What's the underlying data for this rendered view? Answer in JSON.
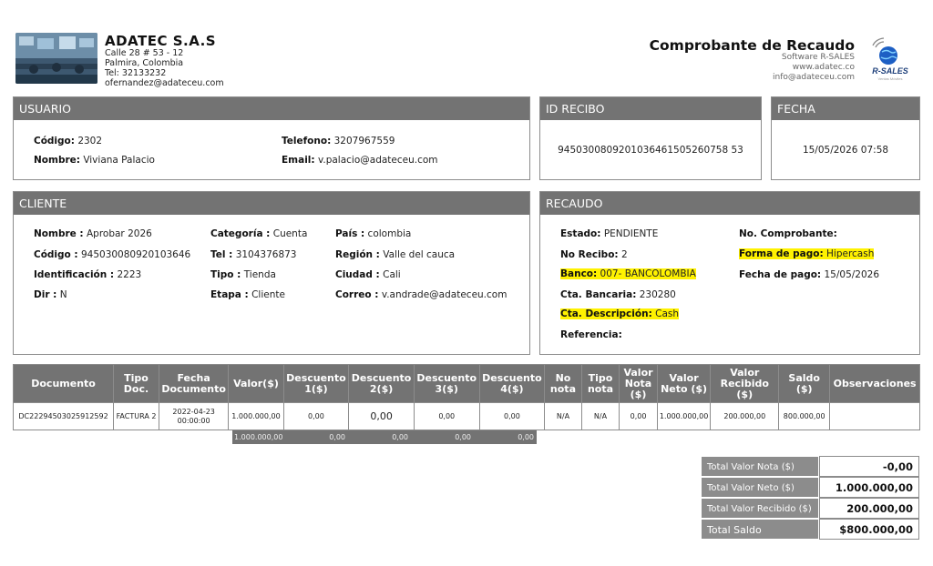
{
  "company": {
    "name": "ADATEC S.A.S",
    "address": "Calle 28 # 53 - 12",
    "city": "Palmira, Colombia",
    "tel": "Tel: 32133232",
    "email": "ofernandez@adateceu.com"
  },
  "document": {
    "title": "Comprobante de Recaudo",
    "software": "Software R-SALES",
    "website": "www.adatec.co",
    "email": "info@adateceu.com"
  },
  "brand_logo": {
    "text": "R-SALES",
    "subtext": "Ventas Móviles",
    "icon": "globe-wifi-icon"
  },
  "usuario": {
    "header": "USUARIO",
    "codigo_label": "Código:",
    "codigo": "2302",
    "nombre_label": "Nombre:",
    "nombre": "Viviana Palacio",
    "telefono_label": "Telefono:",
    "telefono": "3207967559",
    "email_label": "Email:",
    "email": "v.palacio@adateceu.com"
  },
  "id_recibo": {
    "header": "ID RECIBO",
    "value": "9450300809201036461505260758 53"
  },
  "fecha": {
    "header": "FECHA",
    "value": "15/05/2026 07:58"
  },
  "cliente": {
    "header": "CLIENTE",
    "nombre_label": "Nombre :",
    "nombre": "Aprobar 2026",
    "codigo_label": "Código :",
    "codigo": "945030080920103646",
    "identificacion_label": "Identificación :",
    "identificacion": "2223",
    "dir_label": "Dir :",
    "dir": "N",
    "categoria_label": "Categoría :",
    "categoria": "Cuenta",
    "tel_label": "Tel :",
    "tel": "3104376873",
    "tipo_label": "Tipo :",
    "tipo": "Tienda",
    "etapa_label": "Etapa :",
    "etapa": "Cliente",
    "pais_label": "País :",
    "pais": "colombia",
    "region_label": "Región :",
    "region": "Valle del cauca",
    "ciudad_label": "Ciudad :",
    "ciudad": "Cali",
    "correo_label": "Correo :",
    "correo": "v.andrade@adateceu.com"
  },
  "recaudo": {
    "header": "RECAUDO",
    "estado_label": "Estado:",
    "estado": "PENDIENTE",
    "no_recibo_label": "No Recibo:",
    "no_recibo": "2",
    "banco_label": "Banco:",
    "banco": "007- BANCOLOMBIA",
    "cta_bancaria_label": "Cta. Bancaria:",
    "cta_bancaria": "230280",
    "cta_descripcion_label": "Cta. Descripción:",
    "cta_descripcion": "Cash",
    "referencia_label": "Referencia:",
    "no_comprobante_label": "No. Comprobante:",
    "forma_pago_label": "Forma de pago:",
    "forma_pago": "Hipercash",
    "fecha_pago_label": "Fecha de pago:",
    "fecha_pago": "15/05/2026"
  },
  "table": {
    "headers": [
      "Documento",
      "Tipo Doc.",
      "Fecha Documento",
      "Valor($)",
      "Descuento 1($)",
      "Descuento 2($)",
      "Descuento 3($)",
      "Descuento 4($)",
      "No nota",
      "Tipo nota",
      "Valor Nota ($)",
      "Valor Neto ($)",
      "Valor Recibido ($)",
      "Saldo ($)",
      "Observaciones"
    ],
    "rows": [
      [
        "DC22294503025912592",
        "FACTURA 2",
        "2022-04-23 00:00:00",
        "1.000.000,00",
        "0,00",
        "0,00",
        "0,00",
        "0,00",
        "N/A",
        "N/A",
        "0,00",
        "1.000.000,00",
        "200.000,00",
        "800.000,00",
        ""
      ]
    ],
    "subtotals": [
      "1.000.000,00",
      "0,00",
      "0,00",
      "0,00",
      "0,00"
    ]
  },
  "totals": [
    {
      "label": "Total Valor Nota ($)",
      "value": "-0,00"
    },
    {
      "label": "Total Valor Neto ($)",
      "value": "1.000.000,00"
    },
    {
      "label": "Total Valor Recibido ($)",
      "value": "200.000,00"
    },
    {
      "label": "Total Saldo",
      "value": "$800.000,00"
    }
  ]
}
